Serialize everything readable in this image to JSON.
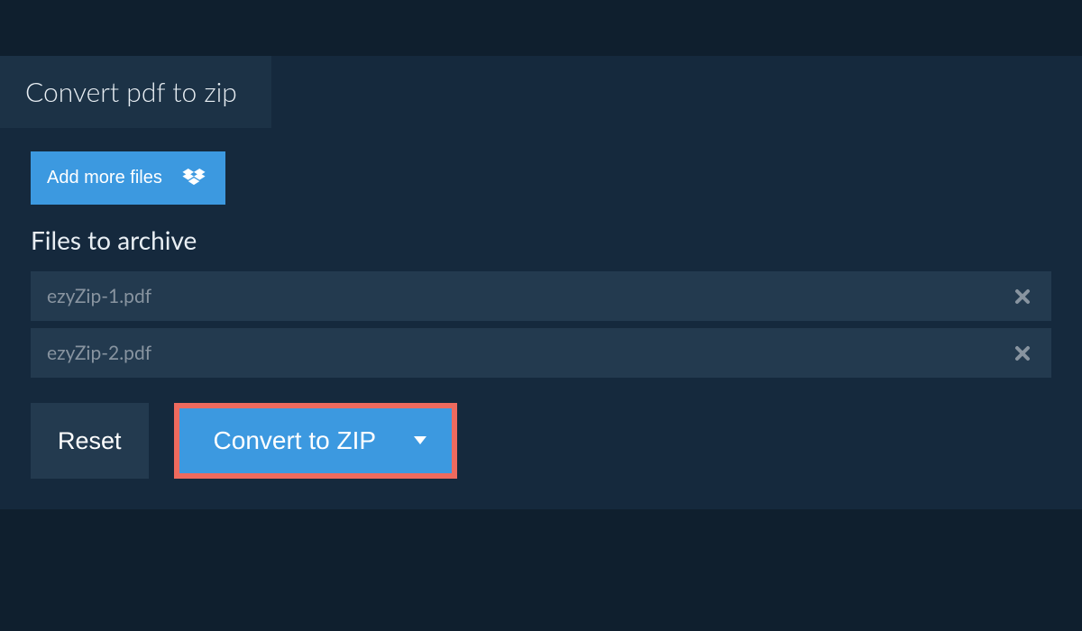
{
  "tab": {
    "title": "Convert pdf to zip"
  },
  "addMore": {
    "label": "Add more files"
  },
  "section": {
    "title": "Files to archive"
  },
  "files": [
    {
      "name": "ezyZip-1.pdf"
    },
    {
      "name": "ezyZip-2.pdf"
    }
  ],
  "actions": {
    "reset": "Reset",
    "convert": "Convert to ZIP"
  },
  "colors": {
    "accent": "#3c99e0",
    "highlight_border": "#ee6a5e",
    "bg_dark": "#0f1f2e",
    "bg_panel": "#15293d",
    "bg_row": "#233a4f"
  }
}
